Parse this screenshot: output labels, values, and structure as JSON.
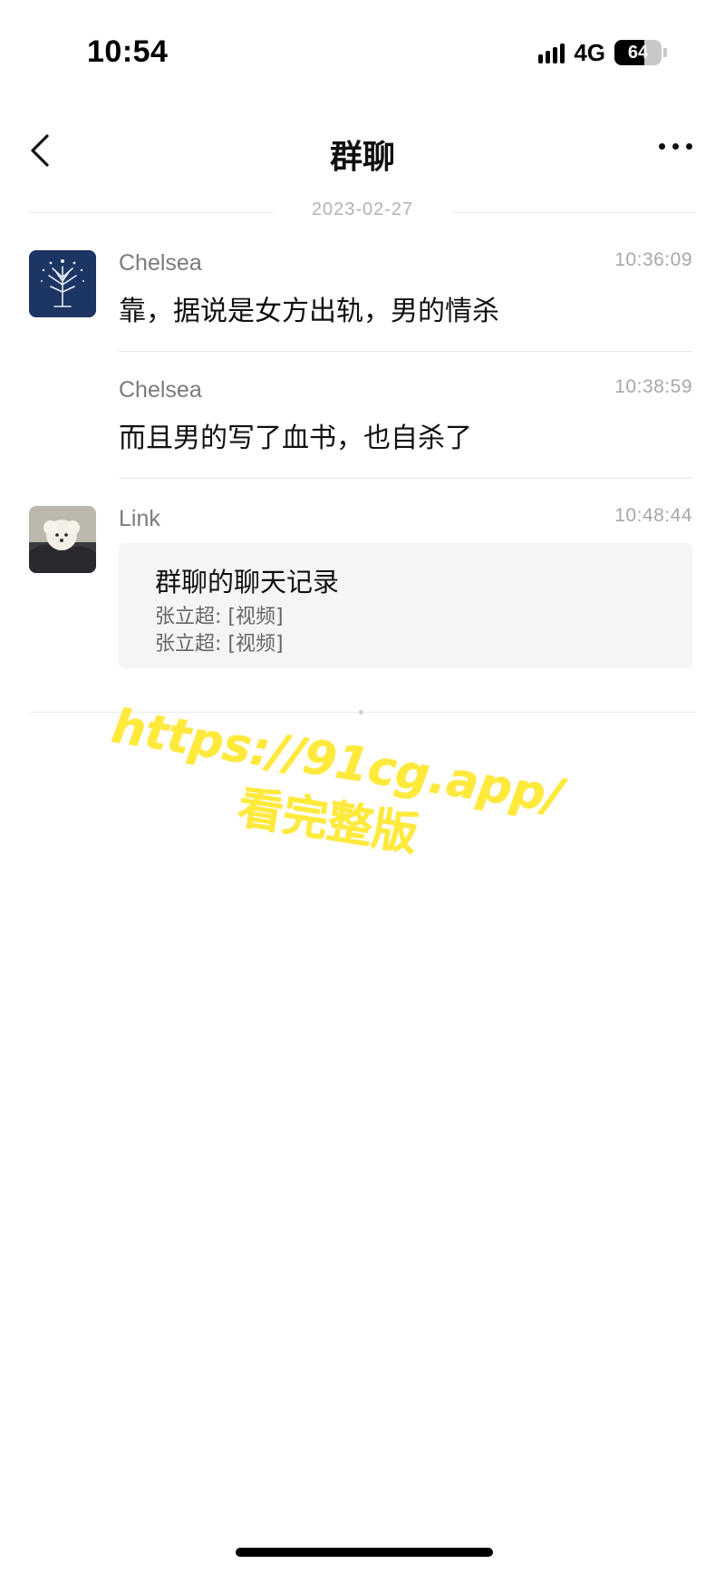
{
  "status_bar": {
    "time": "10:54",
    "network": "4G",
    "battery": "64",
    "battery_fraction": 0.64
  },
  "nav": {
    "title": "群聊",
    "back_icon": "chevron-left-icon",
    "more_icon": "more-horizontal-icon"
  },
  "date_divider": "2023-02-27",
  "messages": [
    {
      "sender": "Chelsea",
      "time": "10:36:09",
      "text": "靠，据说是女方出轨，男的情杀",
      "avatar": "tree-avatar"
    },
    {
      "sender": "Chelsea",
      "time": "10:38:59",
      "text": "而且男的写了血书，也自杀了"
    },
    {
      "sender": "Link",
      "time": "10:48:44",
      "avatar": "dog-avatar",
      "record": {
        "title": "群聊的聊天记录",
        "lines": [
          "张立超: [视频]",
          "张立超: [视频]"
        ]
      }
    }
  ],
  "watermark": {
    "url": "https://91cg.app/",
    "sub": "看完整版"
  },
  "colors": {
    "watermark": "#ffe93b",
    "sender": "#7b7b7b",
    "time": "#a8a8a8",
    "card_bg": "#f5f5f5"
  }
}
